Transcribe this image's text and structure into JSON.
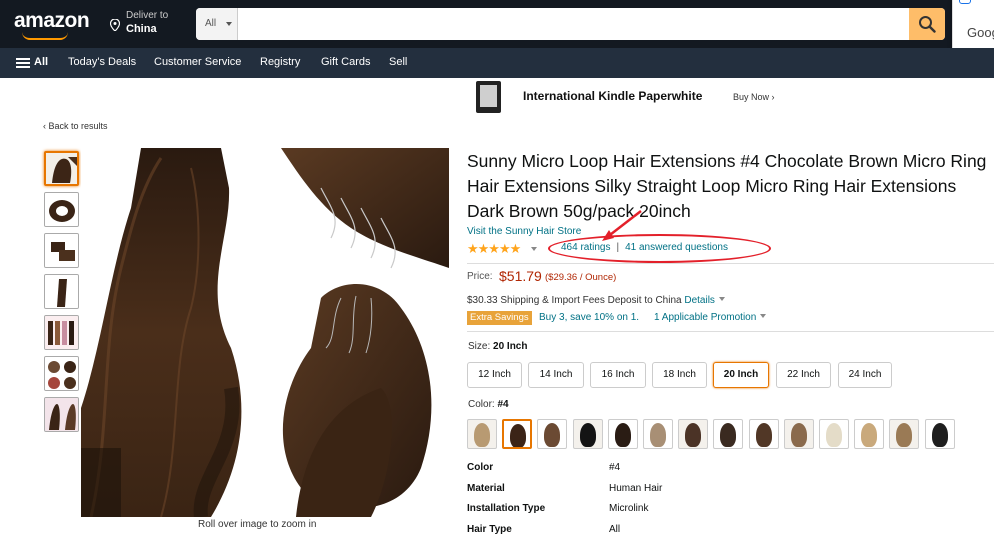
{
  "header": {
    "logo": "amazon",
    "deliver_line1": "Deliver to",
    "deliver_line2": "China",
    "search_category": "All",
    "search_value": "",
    "popup_text": "Goog"
  },
  "nav": {
    "all": "All",
    "items": [
      "Today's Deals",
      "Customer Service",
      "Registry",
      "Gift Cards",
      "Sell"
    ]
  },
  "promo_banner": {
    "title": "International Kindle Paperwhite",
    "cta": "Buy Now ›"
  },
  "back_link": "‹ Back to results",
  "gallery": {
    "caption": "Roll over image to zoom in",
    "thumb_count": 7
  },
  "product": {
    "title": "Sunny Micro Loop Hair Extensions #4 Chocolate Brown Micro Ring Hair Extensions Silky Straight Loop Micro Ring Hair Extensions Dark Brown 50g/pack 20inch",
    "store_link": "Visit the Sunny Hair Store",
    "stars": "★★★★★",
    "rating_value": 4.5,
    "ratings_text": "464 ratings",
    "sep": "|",
    "questions_text": "41 answered questions",
    "price_label": "Price:",
    "price": "$51.79",
    "price_unit": "($29.36 / Ounce)",
    "shipping_text": "$30.33 Shipping & Import Fees Deposit to China",
    "shipping_details": "Details",
    "savings_badge": "Extra Savings",
    "savings_text": "Buy 3, save 10% on 1.",
    "promo_text": "1 Applicable Promotion",
    "size_label": "Size:",
    "size_value": "20 Inch",
    "sizes": [
      "12 Inch",
      "14 Inch",
      "16 Inch",
      "18 Inch",
      "20 Inch",
      "22 Inch",
      "24 Inch"
    ],
    "color_label": "Color:",
    "color_value": "#4",
    "swatch_colors": [
      "#b89a72",
      "#3b2417",
      "#6b4a33",
      "#141414",
      "#2a1c14",
      "#a88f75",
      "#4b3326",
      "#3a2a20",
      "#513726",
      "#8a6a4c",
      "#e4dcc8",
      "#c9a97c",
      "#9a7a55",
      "#1e1e1e"
    ],
    "specs": [
      {
        "k": "Color",
        "v": "#4"
      },
      {
        "k": "Material",
        "v": "Human Hair"
      },
      {
        "k": "Installation Type",
        "v": "Microlink"
      },
      {
        "k": "Hair Type",
        "v": "All"
      }
    ]
  },
  "colors": {
    "nav_dark": "#131921",
    "nav_secondary": "#232f3e",
    "accent": "#febd69",
    "link": "#007185",
    "price": "#b12704",
    "annotation": "#e3202a"
  }
}
